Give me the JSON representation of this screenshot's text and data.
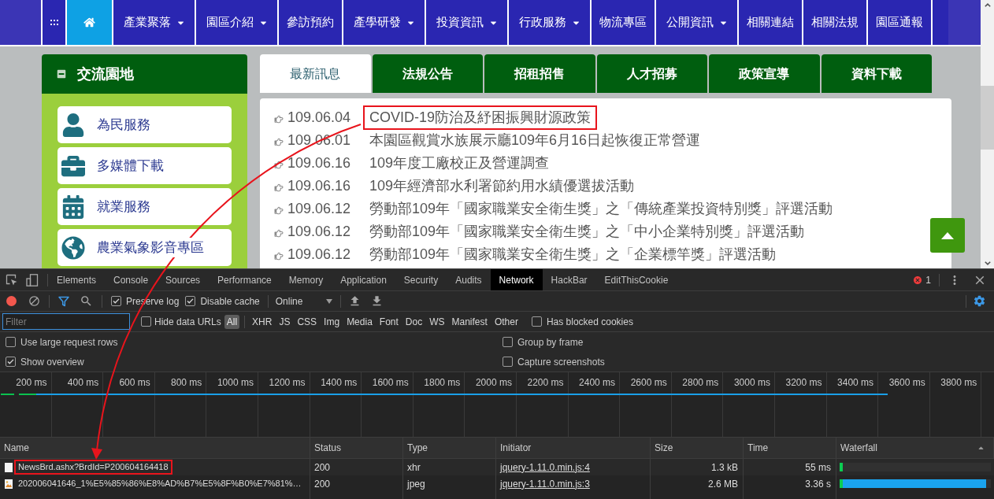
{
  "nav": {
    "items": [
      {
        "kind": "menu",
        "selected": false
      },
      {
        "kind": "home",
        "selected": true
      },
      {
        "kind": "link",
        "label": "產業聚落",
        "dropdown": true,
        "selected": false
      },
      {
        "kind": "link",
        "label": "園區介紹",
        "dropdown": true,
        "selected": false
      },
      {
        "kind": "link",
        "label": "參訪預約",
        "dropdown": false,
        "selected": false
      },
      {
        "kind": "link",
        "label": "產學研發",
        "dropdown": true,
        "selected": false
      },
      {
        "kind": "link",
        "label": "投資資訊",
        "dropdown": true,
        "selected": false
      },
      {
        "kind": "link",
        "label": "行政服務",
        "dropdown": true,
        "selected": false
      },
      {
        "kind": "link",
        "label": "物流專區",
        "dropdown": false,
        "selected": false
      },
      {
        "kind": "link",
        "label": "公開資訊",
        "dropdown": true,
        "selected": false
      },
      {
        "kind": "link",
        "label": "相關連結",
        "dropdown": false,
        "selected": false
      },
      {
        "kind": "link",
        "label": "相關法規",
        "dropdown": false,
        "selected": false
      },
      {
        "kind": "link",
        "label": "園區通報",
        "dropdown": false,
        "selected": false
      }
    ]
  },
  "sidebar": {
    "title": "交流園地",
    "expanded": true,
    "items": [
      {
        "label": "為民服務"
      },
      {
        "label": "多媒體下載"
      },
      {
        "label": "就業服務"
      },
      {
        "label": "農業氣象影音專區"
      }
    ]
  },
  "news_tabs": [
    {
      "label": "最新訊息",
      "selected": true
    },
    {
      "label": "法規公告",
      "selected": false
    },
    {
      "label": "招租招售",
      "selected": false
    },
    {
      "label": "人才招募",
      "selected": false
    },
    {
      "label": "政策宣導",
      "selected": false
    },
    {
      "label": "資料下載",
      "selected": false
    }
  ],
  "news": [
    {
      "date": "109.06.04",
      "title": "COVID-19防治及紓困振興財源政策",
      "highlighted": true
    },
    {
      "date": "109.06.01",
      "title": "本園區觀賞水族展示廳109年6月16日起恢復正常營運",
      "highlighted": false
    },
    {
      "date": "109.06.16",
      "title": "109年度工廠校正及營運調查",
      "highlighted": false
    },
    {
      "date": "109.06.16",
      "title": "109年經濟部水利署節約用水績優選拔活動",
      "highlighted": false
    },
    {
      "date": "109.06.12",
      "title": "勞動部109年「國家職業安全衛生獎」之「傳統產業投資特別獎」評選活動",
      "highlighted": false
    },
    {
      "date": "109.06.12",
      "title": "勞動部109年「國家職業安全衛生獎」之「中小企業特別獎」評選活動",
      "highlighted": false
    },
    {
      "date": "109.06.12",
      "title": "勞動部109年「國家職業安全衛生獎」之「企業標竿獎」評選活動",
      "highlighted": false
    }
  ],
  "devtools": {
    "tabs": [
      {
        "label": "Elements",
        "selected": false
      },
      {
        "label": "Console",
        "selected": false
      },
      {
        "label": "Sources",
        "selected": false
      },
      {
        "label": "Performance",
        "selected": false
      },
      {
        "label": "Memory",
        "selected": false
      },
      {
        "label": "Application",
        "selected": false
      },
      {
        "label": "Security",
        "selected": false
      },
      {
        "label": "Audits",
        "selected": false
      },
      {
        "label": "Network",
        "selected": true
      },
      {
        "label": "HackBar",
        "selected": false
      },
      {
        "label": "EditThisCookie",
        "selected": false
      }
    ],
    "error_count": "1",
    "toolbar": {
      "recording": true,
      "filter_active": true,
      "options": [
        {
          "label": "Preserve log",
          "checked": true
        },
        {
          "label": "Disable cache",
          "checked": true
        }
      ],
      "throttling": "Online"
    },
    "filter": {
      "placeholder": "Filter",
      "hide_data_urls": {
        "label": "Hide data URLs",
        "checked": false
      },
      "types": [
        {
          "label": "All",
          "selected": true
        },
        {
          "label": "XHR",
          "selected": false
        },
        {
          "label": "JS",
          "selected": false
        },
        {
          "label": "CSS",
          "selected": false
        },
        {
          "label": "Img",
          "selected": false
        },
        {
          "label": "Media",
          "selected": false
        },
        {
          "label": "Font",
          "selected": false
        },
        {
          "label": "Doc",
          "selected": false
        },
        {
          "label": "WS",
          "selected": false
        },
        {
          "label": "Manifest",
          "selected": false
        },
        {
          "label": "Other",
          "selected": false
        }
      ],
      "blocked_cookies": {
        "label": "Has blocked cookies",
        "checked": false
      }
    },
    "settings": [
      {
        "label": "Use large request rows",
        "checked": false
      },
      {
        "label": "Group by frame",
        "checked": false
      },
      {
        "label": "Show overview",
        "checked": true
      },
      {
        "label": "Capture screenshots",
        "checked": false
      }
    ],
    "overview": {
      "ticks": [
        "200 ms",
        "400 ms",
        "600 ms",
        "800 ms",
        "1000 ms",
        "1200 ms",
        "1400 ms",
        "1600 ms",
        "1800 ms",
        "2000 ms",
        "2200 ms",
        "2400 ms",
        "2600 ms",
        "2800 ms",
        "3000 ms",
        "3200 ms",
        "3400 ms",
        "3600 ms",
        "3800 ms"
      ]
    },
    "table": {
      "columns": [
        {
          "label": "Name",
          "sorted": false
        },
        {
          "label": "Status",
          "sorted": false
        },
        {
          "label": "Type",
          "sorted": false
        },
        {
          "label": "Initiator",
          "sorted": false
        },
        {
          "label": "Size",
          "sorted": false
        },
        {
          "label": "Time",
          "sorted": false
        },
        {
          "label": "Waterfall",
          "sorted": true
        }
      ],
      "rows": [
        {
          "kind": "document",
          "name": "NewsBrd.ashx?BrdId=P200604164418",
          "highlighted": true,
          "status": "200",
          "type": "xhr",
          "initiator": "jquery-1.11.0.min.js:4",
          "size": "1.3 kB",
          "time": "55 ms",
          "level": 0.02
        },
        {
          "kind": "image",
          "name": "202006041646_1%E5%85%86%E8%AD%B7%E5%8F%B0%E7%81%…",
          "highlighted": false,
          "status": "200",
          "type": "jpeg",
          "initiator": "jquery-1.11.0.min.js:3",
          "size": "2.6 MB",
          "time": "3.36 s",
          "level": 0.97
        }
      ]
    }
  }
}
